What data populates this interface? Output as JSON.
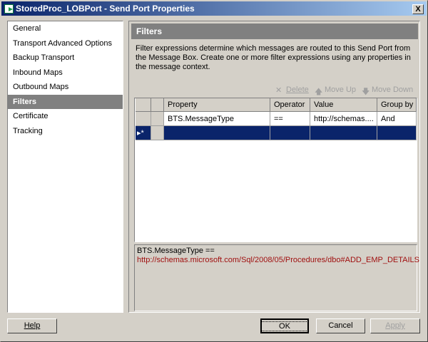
{
  "window": {
    "title": "StoredProc_LOBPort - Send Port Properties",
    "close_label": "X"
  },
  "nav": {
    "items": [
      "General",
      "Transport Advanced Options",
      "Backup Transport",
      "Inbound Maps",
      "Outbound Maps",
      "Filters",
      "Certificate",
      "Tracking"
    ],
    "selected": "Filters"
  },
  "panel": {
    "header": "Filters",
    "description": "Filter expressions determine which messages are routed to this Send Port from the Message Box. Create one or more filter expressions using any properties in the message context."
  },
  "toolbar": {
    "delete": "Delete",
    "move_up": "Move Up",
    "move_down": "Move Down"
  },
  "grid": {
    "columns": [
      "Property",
      "Operator",
      "Value",
      "Group by"
    ],
    "rows": [
      {
        "property": "BTS.MessageType",
        "operator": "==",
        "value": "http://schemas....",
        "group_by": "And"
      }
    ],
    "new_row_marker": "▸*"
  },
  "expression": {
    "line1": "BTS.MessageType ==",
    "line2": "http://schemas.microsoft.com/Sql/2008/05/Procedures/dbo#ADD_EMP_DETAILS"
  },
  "buttons": {
    "help": "Help",
    "ok": "OK",
    "cancel": "Cancel",
    "apply": "Apply"
  }
}
